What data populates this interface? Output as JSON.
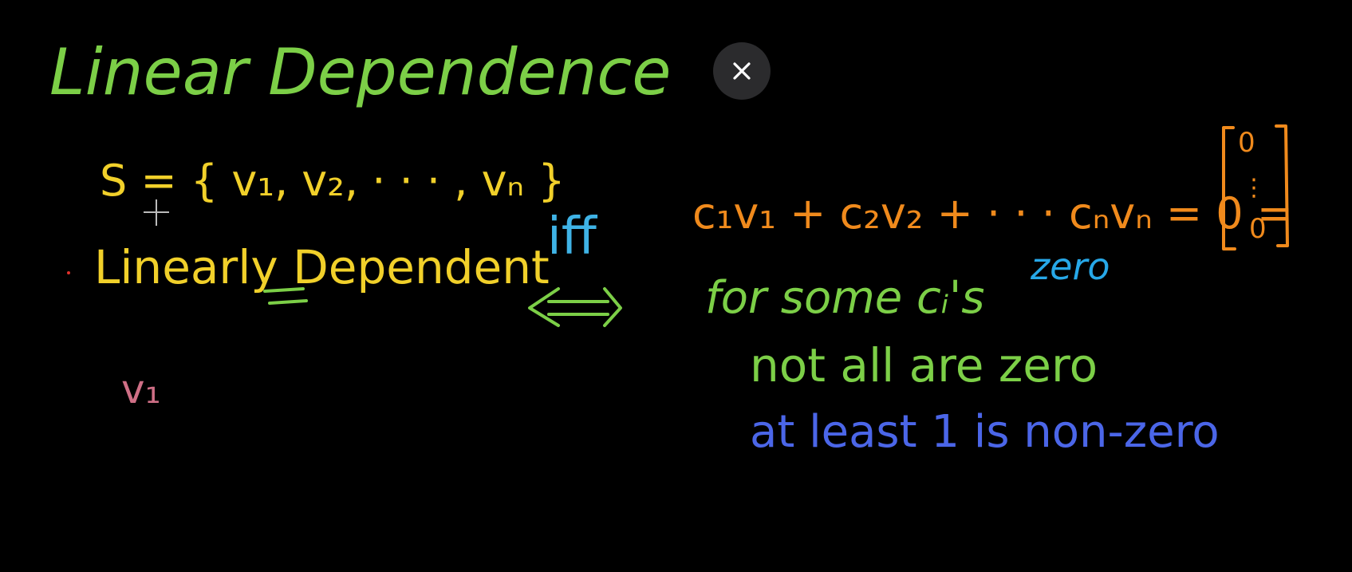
{
  "overlay": {
    "close_icon": "close-icon",
    "close_button_background": "#2b2b2d"
  },
  "board": {
    "background": "#000000",
    "title": "Linear Dependence",
    "set_definition": "S = { v₁, v₂, · · · , vₙ }",
    "term": "Linearly Dependent",
    "sample_vector": "v₁",
    "connector": "iff",
    "equation_lhs": "c₁v₁ + c₂v₂ + · · · cₙvₙ = 0 =",
    "zero_vector": [
      "0",
      "⋮",
      "0"
    ],
    "condition_1": "for some cᵢ's",
    "condition_1_note": "zero",
    "condition_2": "not all are zero",
    "condition_3": "at least 1 is non-zero",
    "colors": {
      "title": "#7ccf47",
      "set": "#f1d02a",
      "term": "#f1d02a",
      "term_underline": "#7ccf47",
      "vector": "#cf6f86",
      "connector": "#3fb3e6",
      "arrow": "#7ccf47",
      "equation": "#f08a1c",
      "condition": "#7ccf47",
      "note": "#27a8e8",
      "non_zero": "#4b66e8"
    }
  }
}
